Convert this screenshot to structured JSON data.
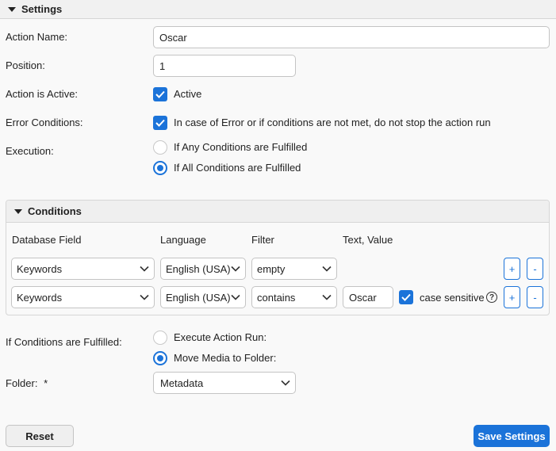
{
  "settings_header": "Settings",
  "form": {
    "action_name_label": "Action Name:",
    "action_name_value": "Oscar",
    "position_label": "Position:",
    "position_value": "1",
    "active_label": "Action is Active:",
    "active_text": "Active",
    "active_checked": true,
    "error_label": "Error Conditions:",
    "error_text": "In case of Error or if conditions are not met, do not stop the action run",
    "error_checked": true,
    "execution_label": "Execution:",
    "execution_options": [
      "If Any Conditions are Fulfilled",
      "If All Conditions are Fulfilled"
    ],
    "execution_selected": "If All Conditions are Fulfilled"
  },
  "conditions": {
    "header": "Conditions",
    "columns": [
      "Database Field",
      "Language",
      "Filter",
      "Text, Value"
    ],
    "rows": [
      {
        "field": "Keywords",
        "language": "English (USA)",
        "filter": "empty",
        "value": ""
      },
      {
        "field": "Keywords",
        "language": "English (USA)",
        "filter": "contains",
        "value": "Oscar",
        "case_sensitive_label": "case sensitive",
        "case_sensitive": true
      }
    ],
    "add_label": "+",
    "remove_label": "-",
    "help_label": "?"
  },
  "fulfilled": {
    "label": "If Conditions are Fulfilled:",
    "options": [
      "Execute Action Run:",
      "Move Media to Folder:"
    ],
    "selected": "Move Media to Folder:"
  },
  "folder": {
    "label": "Folder:",
    "required_mark": "*",
    "value": "Metadata"
  },
  "buttons": {
    "reset": "Reset",
    "save": "Save Settings"
  },
  "colors": {
    "accent": "#1b73d9",
    "background": "#f9f9f9"
  },
  "icons": {
    "collapse": "triangle-down-icon",
    "dropdown": "chevron-down-icon",
    "check": "checkmark-icon",
    "help": "question-circle-icon"
  }
}
